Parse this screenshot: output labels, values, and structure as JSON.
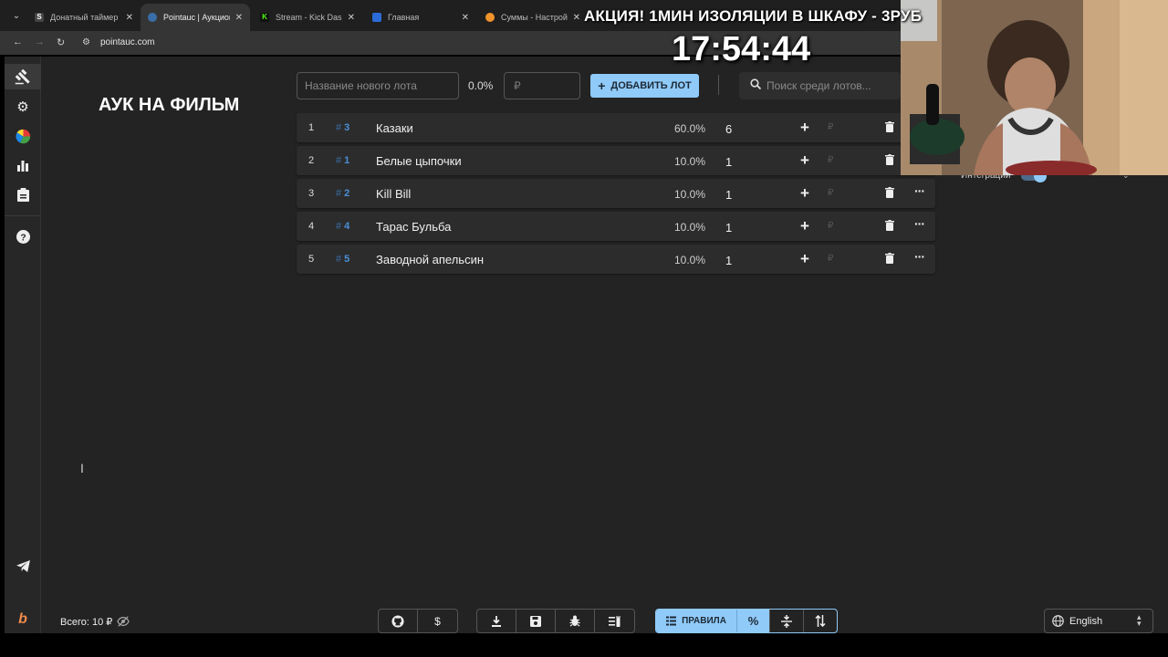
{
  "browser": {
    "tabs": [
      {
        "label": "Донатный таймер (н",
        "favicon_color": "#444444",
        "favicon_glyph": "S"
      },
      {
        "label": "Pointauc | Аукцион д",
        "favicon_color": "#3a6ea8",
        "favicon_glyph": "◎",
        "active": true
      },
      {
        "label": "Stream - Kick Dashbo",
        "favicon_color": "#53fc18",
        "favicon_glyph": "K"
      },
      {
        "label": "Главная",
        "favicon_color": "#2b6bd8",
        "favicon_glyph": "||"
      },
      {
        "label": "Суммы - Настройки",
        "favicon_color": "#f0932b",
        "favicon_glyph": "D"
      }
    ],
    "url": "pointauc.com"
  },
  "overlay": {
    "promo": "АКЦИЯ! 1МИН ИЗОЛЯЦИИ В ШКАФУ - 3РУБ",
    "timer": "17:54:44"
  },
  "sidebar": {
    "icons": [
      "gavel-icon",
      "gear-icon",
      "pie-chart-icon",
      "bar-chart-icon",
      "clipboard-icon",
      "help-icon",
      "telegram-icon",
      "brand-icon"
    ]
  },
  "auction": {
    "title": "АУК НА ФИЛЬМ",
    "new_lot_placeholder": "Название нового лота",
    "new_lot_percent": "0.0%",
    "amount_placeholder": "₽",
    "add_button": "ДОБАВИТЬ ЛОТ",
    "search_placeholder": "Поиск среди лотов...",
    "lots": [
      {
        "index": "1",
        "id": "3",
        "name": "Казаки",
        "percent": "60.0%",
        "amount": "6"
      },
      {
        "index": "2",
        "id": "1",
        "name": "Белые цыпочки",
        "percent": "10.0%",
        "amount": "1"
      },
      {
        "index": "3",
        "id": "2",
        "name": "Kill Bill",
        "percent": "10.0%",
        "amount": "1"
      },
      {
        "index": "4",
        "id": "4",
        "name": "Тарас Бульба",
        "percent": "10.0%",
        "amount": "1"
      },
      {
        "index": "5",
        "id": "5",
        "name": "Заводной апельсин",
        "percent": "10.0%",
        "amount": "1"
      }
    ],
    "currency": "₽"
  },
  "integrations": {
    "label": "Интеграции"
  },
  "footer": {
    "total": "Всего: 10 ₽",
    "rules_label": "ПРАВИЛА",
    "percent_label": "%",
    "language": "English"
  },
  "colors": {
    "accent": "#90caf9",
    "background": "#232323",
    "id_blue": "#4a8fd8"
  }
}
